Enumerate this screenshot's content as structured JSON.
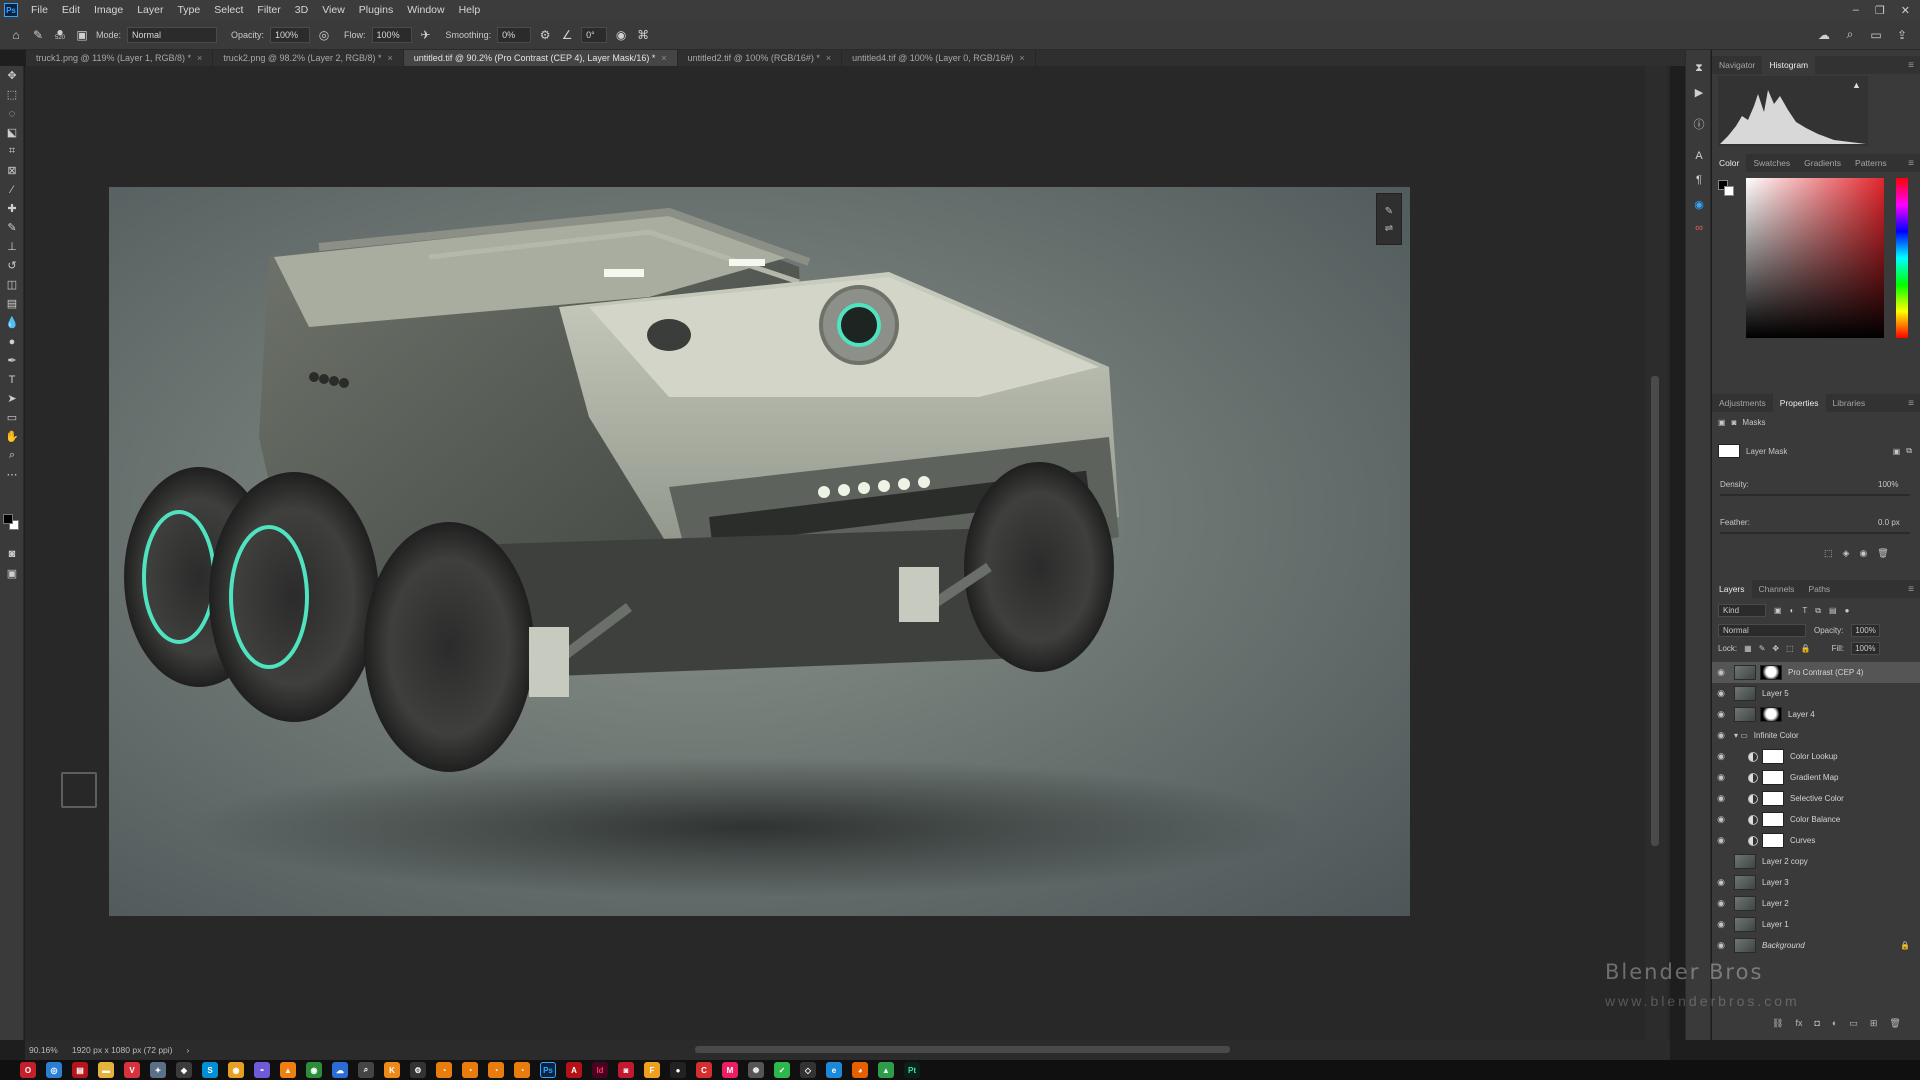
{
  "menu": {
    "logo": "Ps",
    "items": [
      "File",
      "Edit",
      "Image",
      "Layer",
      "Type",
      "Select",
      "Filter",
      "3D",
      "View",
      "Plugins",
      "Window",
      "Help"
    ]
  },
  "options_bar": {
    "brush_size": "520",
    "mode_label": "Mode:",
    "mode_value": "Normal",
    "opacity_label": "Opacity:",
    "opacity_value": "100%",
    "flow_label": "Flow:",
    "flow_value": "100%",
    "smoothing_label": "Smoothing:",
    "smoothing_value": "0%",
    "angle_value": "0°"
  },
  "tabs": [
    {
      "label": "truck1.png @ 119% (Layer 1, RGB/8) *",
      "active": false
    },
    {
      "label": "truck2.png @ 98.2% (Layer 2, RGB/8) *",
      "active": false
    },
    {
      "label": "untitled.tif @ 90.2% (Pro Contrast (CEP 4), Layer Mask/16) *",
      "active": true
    },
    {
      "label": "untitled2.tif @ 100% (RGB/16#) *",
      "active": false
    },
    {
      "label": "untitled4.tif @ 100% (Layer 0, RGB/16#)",
      "active": false
    }
  ],
  "tab_close_glyph": "×",
  "status": {
    "zoom": "90.16%",
    "doc_info": "1920 px x 1080 px (72 ppi)"
  },
  "panels": {
    "top_tabs": [
      "Navigator",
      "Histogram"
    ],
    "color_tabs": [
      "Color",
      "Swatches",
      "Gradients",
      "Patterns"
    ],
    "props_tabs": [
      "Adjustments",
      "Properties",
      "Libraries"
    ],
    "masks_label": "Masks",
    "layer_mask_label": "Layer Mask",
    "density_label": "Density:",
    "density_value": "100%",
    "feather_label": "Feather:",
    "feather_value": "0.0 px",
    "layers_tabs": [
      "Layers",
      "Channels",
      "Paths"
    ],
    "kind_label": "Kind",
    "blend_mode": "Normal",
    "opacity_label": "Opacity:",
    "opacity_value": "100%",
    "lock_label": "Lock:",
    "fill_label": "Fill:",
    "fill_value": "100%"
  },
  "layers": [
    {
      "name": "Pro Contrast (CEP 4)",
      "type": "smart-mask",
      "visible": true,
      "selected": true,
      "indent": 0
    },
    {
      "name": "Layer 5",
      "type": "pixel",
      "visible": true,
      "selected": false,
      "indent": 0
    },
    {
      "name": "Layer 4",
      "type": "pixel-mask",
      "visible": true,
      "selected": false,
      "indent": 0
    },
    {
      "name": "Infinite Color",
      "type": "group",
      "visible": true,
      "selected": false,
      "indent": 0
    },
    {
      "name": "Color Lookup",
      "type": "adjustment",
      "visible": true,
      "selected": false,
      "indent": 1
    },
    {
      "name": "Gradient Map",
      "type": "adjustment",
      "visible": true,
      "selected": false,
      "indent": 1
    },
    {
      "name": "Selective Color",
      "type": "adjustment",
      "visible": true,
      "selected": false,
      "indent": 1
    },
    {
      "name": "Color Balance",
      "type": "adjustment",
      "visible": true,
      "selected": false,
      "indent": 1
    },
    {
      "name": "Curves",
      "type": "adjustment",
      "visible": true,
      "selected": false,
      "indent": 1
    },
    {
      "name": "Layer 2 copy",
      "type": "pixel",
      "visible": false,
      "selected": false,
      "indent": 0
    },
    {
      "name": "Layer 3",
      "type": "pixel",
      "visible": true,
      "selected": false,
      "indent": 0
    },
    {
      "name": "Layer 2",
      "type": "pixel",
      "visible": true,
      "selected": false,
      "indent": 0
    },
    {
      "name": "Layer 1",
      "type": "pixel",
      "visible": true,
      "selected": false,
      "indent": 0
    },
    {
      "name": "Background",
      "type": "background",
      "visible": true,
      "selected": false,
      "indent": 0
    }
  ],
  "watermark": {
    "brand": "Blender Bros",
    "url": "www.blenderbros.com"
  },
  "colors": {
    "accent_glow": "#4fe3c0",
    "ps_blue": "#31a8ff",
    "panel_bg": "#3a3a3a"
  }
}
